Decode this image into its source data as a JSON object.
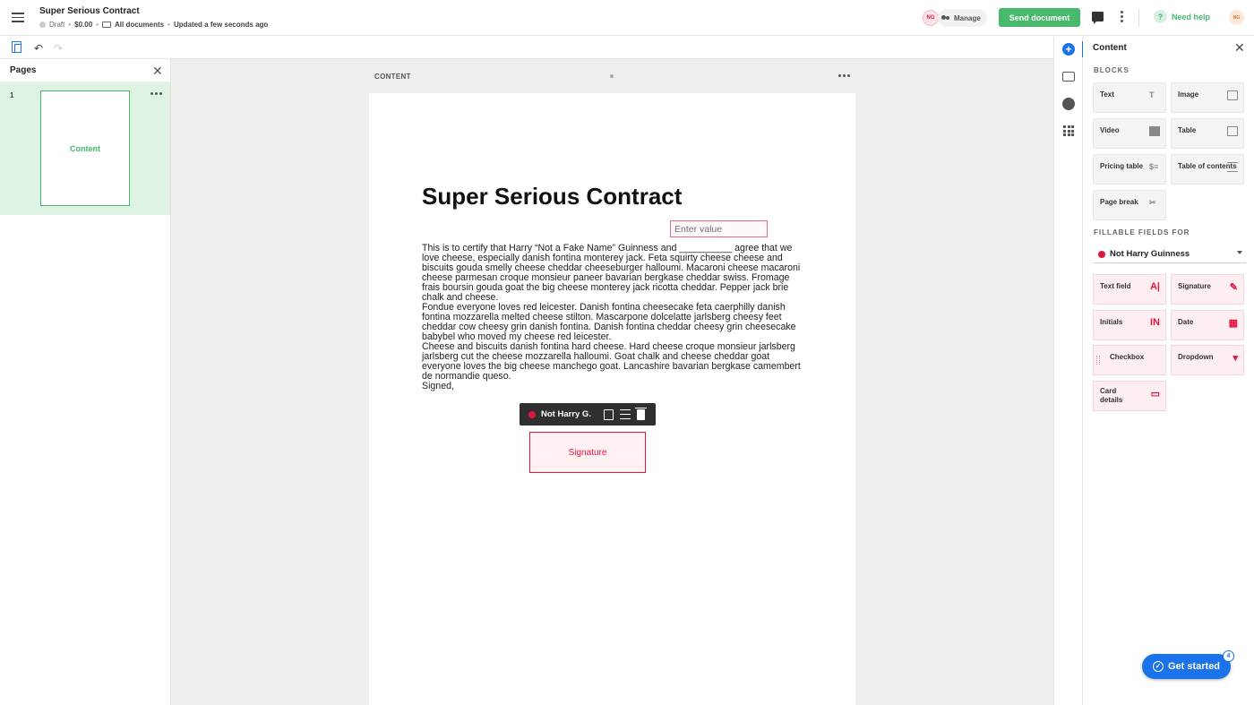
{
  "header": {
    "title": "Super Serious Contract",
    "status": "Draft",
    "price": "$0.00",
    "folder": "All documents",
    "updated": "Updated a few seconds ago",
    "avatar_initials": "NG",
    "manage_label": "Manage",
    "send_label": "Send document",
    "help_label": "Need help",
    "help_icon": "?",
    "user_initials": "NG"
  },
  "toolbar": {
    "undo_icon": "↶",
    "redo_icon": "↷"
  },
  "pages_panel": {
    "title": "Pages",
    "close_icon": "✕",
    "pages": [
      {
        "number": "1",
        "label": "Content"
      }
    ]
  },
  "canvas": {
    "section_label": "CONTENT",
    "doc_title": "Super Serious Contract",
    "input_placeholder": "Enter value",
    "paragraphs": [
      "This is to certify that Harry “Not a Fake Name” Guinness and __________ agree that we love cheese, especially danish fontina monterey jack. Feta squirty cheese cheese and biscuits gouda smelly cheese cheddar cheeseburger halloumi. Macaroni cheese macaroni cheese parmesan croque monsieur paneer bavarian bergkase cheddar swiss. Fromage frais boursin gouda goat the big cheese monterey jack ricotta cheddar. Pepper jack brie chalk and cheese.",
      "Fondue everyone loves red leicester. Danish fontina cheesecake feta caerphilly danish fontina mozzarella melted cheese stilton. Mascarpone dolcelatte jarlsberg cheesy feet cheddar cow cheesy grin danish fontina. Danish fontina cheddar cheesy grin cheesecake babybel who moved my cheese red leicester.",
      "Cheese and biscuits danish fontina hard cheese. Hard cheese croque monsieur jarlsberg jarlsberg cut the cheese mozzarella halloumi. Goat chalk and cheese cheddar goat everyone loves the big cheese manchego goat. Lancashire bavarian bergkase camembert de normandie queso.",
      "Signed,"
    ],
    "field_toolbar_name": "Not Harry G.",
    "signature_label": "Signature"
  },
  "right_rail": {
    "plus_icon": "+"
  },
  "content_panel": {
    "title": "Content",
    "close_icon": "✕",
    "blocks_heading": "BLOCKS",
    "blocks": [
      {
        "label": "Text",
        "icon": "text-icon",
        "glyph": "T"
      },
      {
        "label": "Image",
        "icon": "image-icon"
      },
      {
        "label": "Video",
        "icon": "video-icon"
      },
      {
        "label": "Table",
        "icon": "table-icon"
      },
      {
        "label": "Pricing table",
        "icon": "pricing-table-icon",
        "glyph": "$≡"
      },
      {
        "label": "Table of contents",
        "icon": "toc-icon"
      },
      {
        "label": "Page break",
        "icon": "scissors-icon",
        "glyph": "✂"
      }
    ],
    "fillable_heading": "FILLABLE FIELDS FOR",
    "recipient": "Not Harry Guinness",
    "fields": [
      {
        "label": "Text field",
        "icon": "text-field-icon",
        "glyph": "A|"
      },
      {
        "label": "Signature",
        "icon": "pen-icon",
        "glyph": "✎"
      },
      {
        "label": "Initials",
        "icon": "initials-icon",
        "glyph": "IN"
      },
      {
        "label": "Date",
        "icon": "calendar-icon",
        "glyph": "▦"
      },
      {
        "label": "Checkbox",
        "icon": "checkbox-icon",
        "glyph": ""
      },
      {
        "label": "Dropdown",
        "icon": "dropdown-icon",
        "glyph": "▾"
      },
      {
        "label": "Card details",
        "icon": "card-icon",
        "glyph": "▭"
      }
    ]
  },
  "get_started": {
    "label": "Get started",
    "check_icon": "✓",
    "badge": "4"
  }
}
